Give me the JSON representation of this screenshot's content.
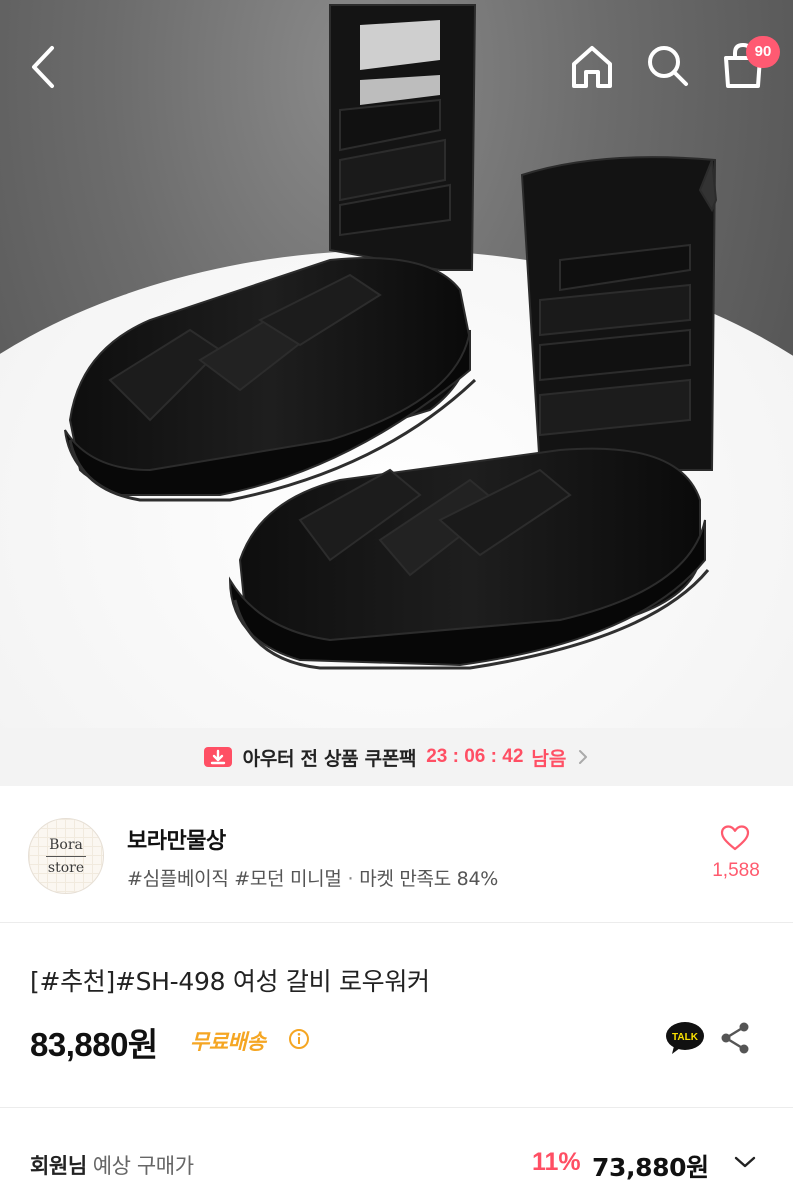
{
  "header": {
    "back_icon": "chevron-left-icon",
    "home_icon": "home-icon",
    "search_icon": "search-icon",
    "cart_icon": "shopping-bag-icon",
    "cart_count": "90"
  },
  "coupon_banner": {
    "icon": "download-coupon-icon",
    "text": "아우터 전 상품 쿠폰팩",
    "timer": "23 : 06 : 42",
    "remaining": "남음",
    "accent_color": "#ff4f64"
  },
  "store": {
    "logo_line1": "Bora",
    "logo_line2": "store",
    "name": "보라만물상",
    "tags": "#심플베이직 #모던 미니멀",
    "satisfaction": "마켓 만족도 84%",
    "like_icon": "heart-icon",
    "likes": "1,588"
  },
  "product": {
    "title": "[#추천]#SH-498 여성 갈비 로우워커",
    "price": "83,880원",
    "shipping": "무료배송",
    "shipping_color": "#f5a623",
    "talk_label": "TALK",
    "share_icon": "share-icon"
  },
  "member_price": {
    "label_bold": "회원님",
    "label_sub": "예상 구매가",
    "discount": "11%",
    "price": "73,880원"
  }
}
